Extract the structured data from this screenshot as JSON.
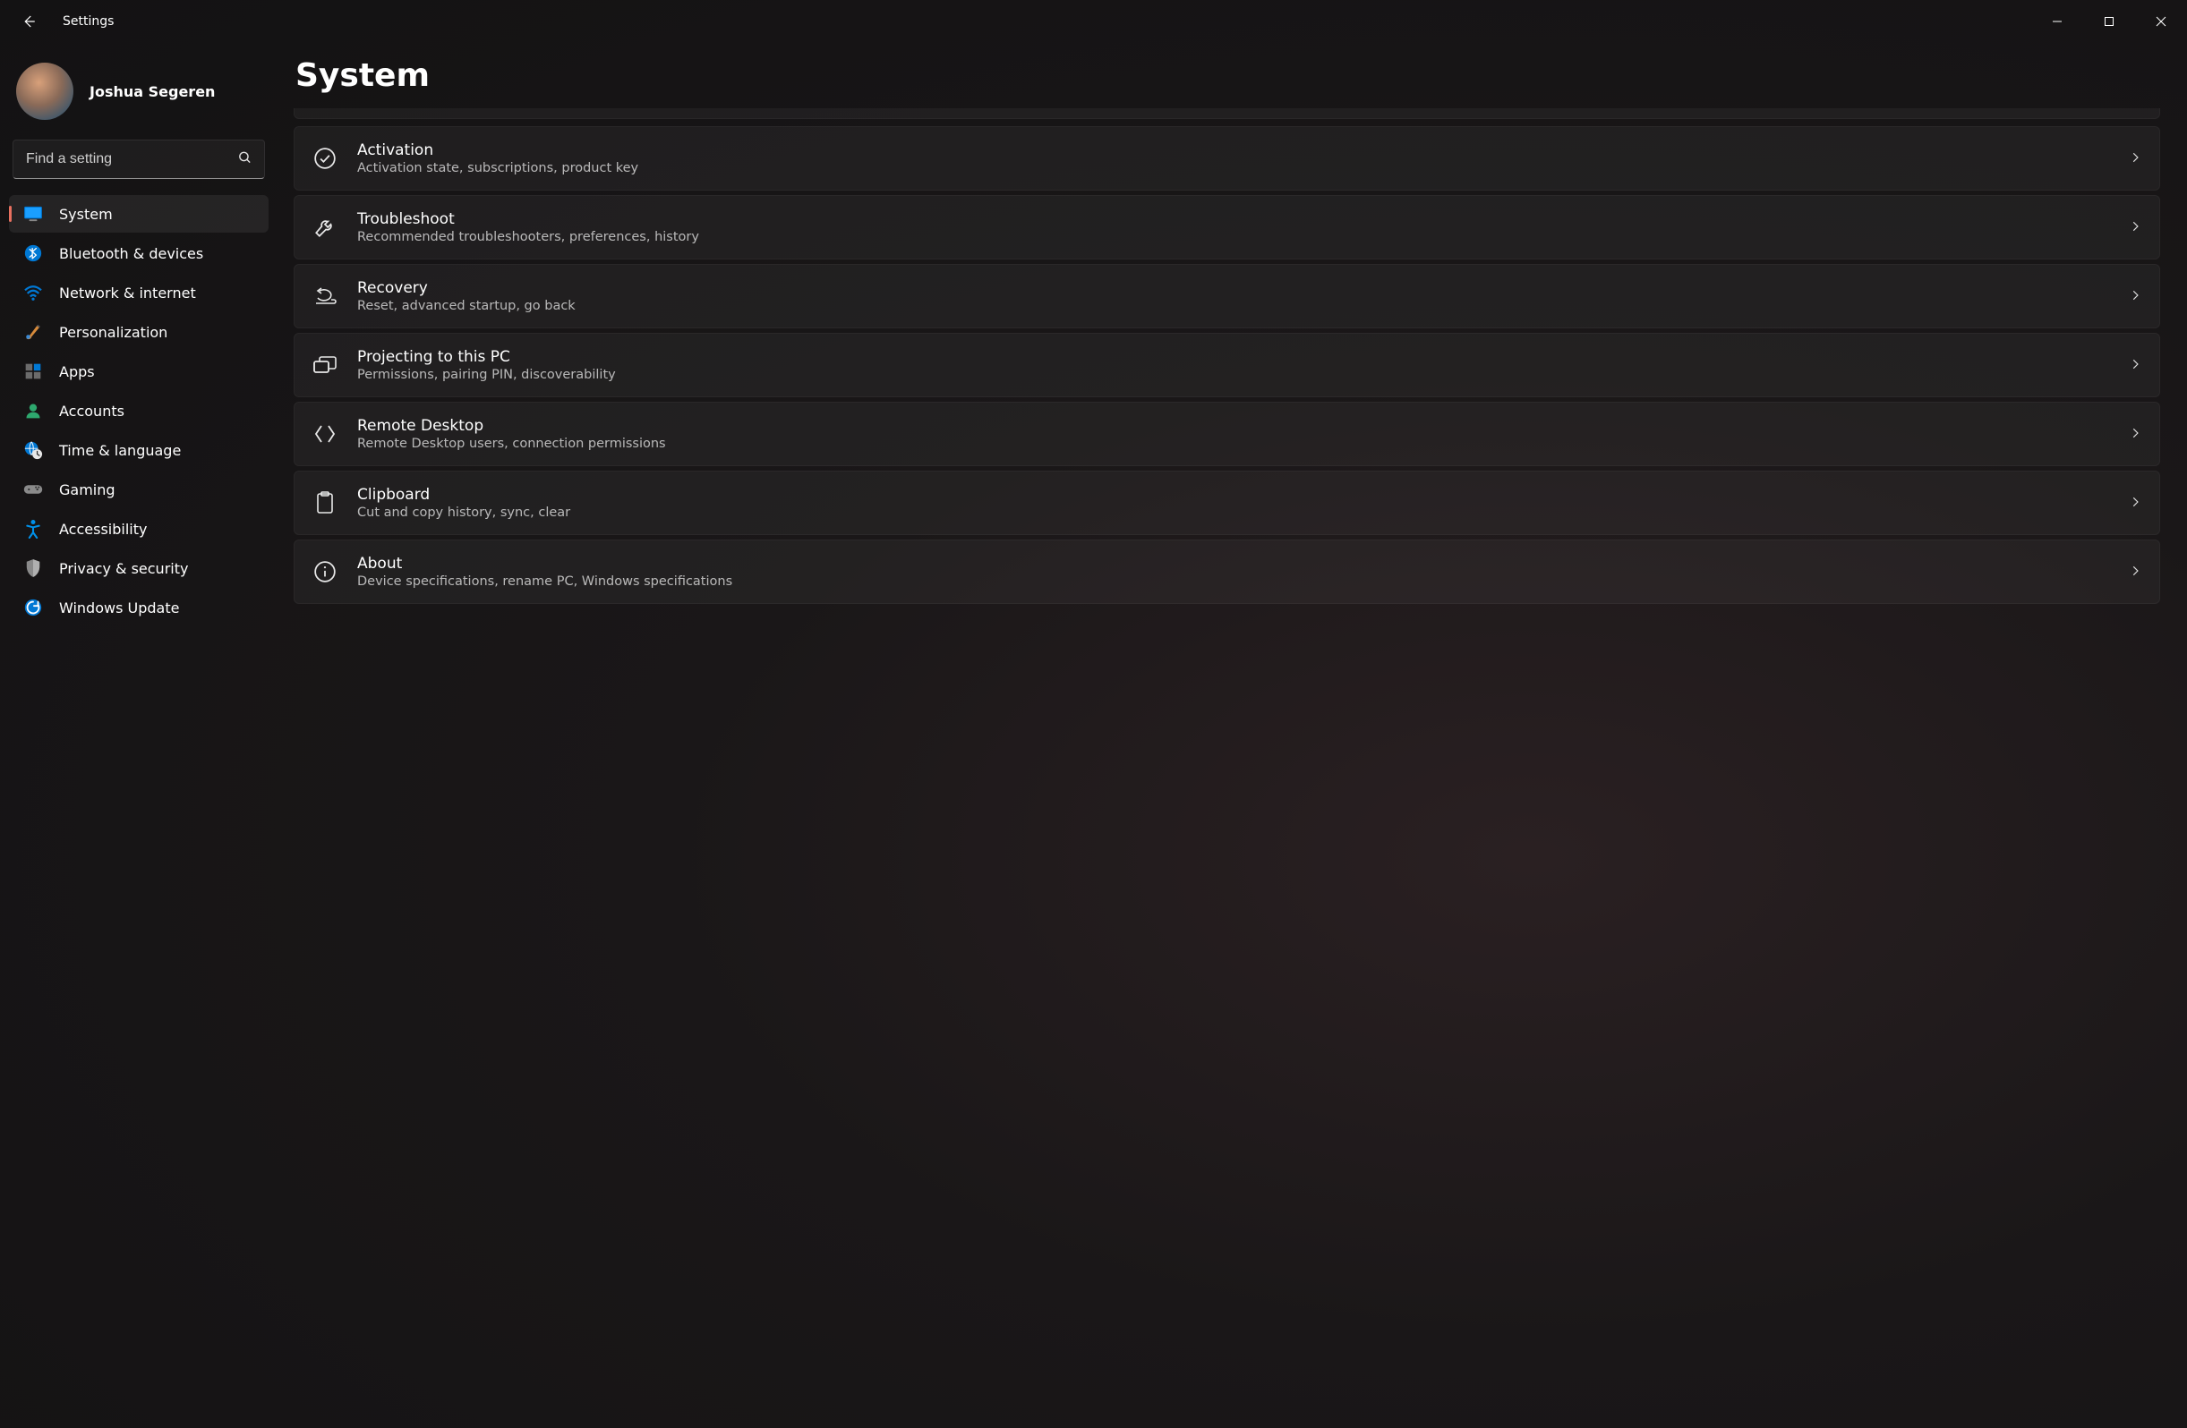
{
  "window": {
    "title": "Settings"
  },
  "user": {
    "name": "Joshua Segeren"
  },
  "search": {
    "placeholder": "Find a setting"
  },
  "sidebar": {
    "items": [
      {
        "id": "system",
        "label": "System",
        "active": true
      },
      {
        "id": "bluetooth",
        "label": "Bluetooth & devices",
        "active": false
      },
      {
        "id": "network",
        "label": "Network & internet",
        "active": false
      },
      {
        "id": "personalization",
        "label": "Personalization",
        "active": false
      },
      {
        "id": "apps",
        "label": "Apps",
        "active": false
      },
      {
        "id": "accounts",
        "label": "Accounts",
        "active": false
      },
      {
        "id": "time",
        "label": "Time & language",
        "active": false
      },
      {
        "id": "gaming",
        "label": "Gaming",
        "active": false
      },
      {
        "id": "accessibility",
        "label": "Accessibility",
        "active": false
      },
      {
        "id": "privacy",
        "label": "Privacy & security",
        "active": false
      },
      {
        "id": "update",
        "label": "Windows Update",
        "active": false
      }
    ]
  },
  "main": {
    "heading": "System",
    "cards": [
      {
        "id": "activation",
        "title": "Activation",
        "desc": "Activation state, subscriptions, product key"
      },
      {
        "id": "troubleshoot",
        "title": "Troubleshoot",
        "desc": "Recommended troubleshooters, preferences, history"
      },
      {
        "id": "recovery",
        "title": "Recovery",
        "desc": "Reset, advanced startup, go back"
      },
      {
        "id": "projecting",
        "title": "Projecting to this PC",
        "desc": "Permissions, pairing PIN, discoverability"
      },
      {
        "id": "remote",
        "title": "Remote Desktop",
        "desc": "Remote Desktop users, connection permissions"
      },
      {
        "id": "clipboard",
        "title": "Clipboard",
        "desc": "Cut and copy history, sync, clear"
      },
      {
        "id": "about",
        "title": "About",
        "desc": "Device specifications, rename PC, Windows specifications"
      }
    ]
  }
}
